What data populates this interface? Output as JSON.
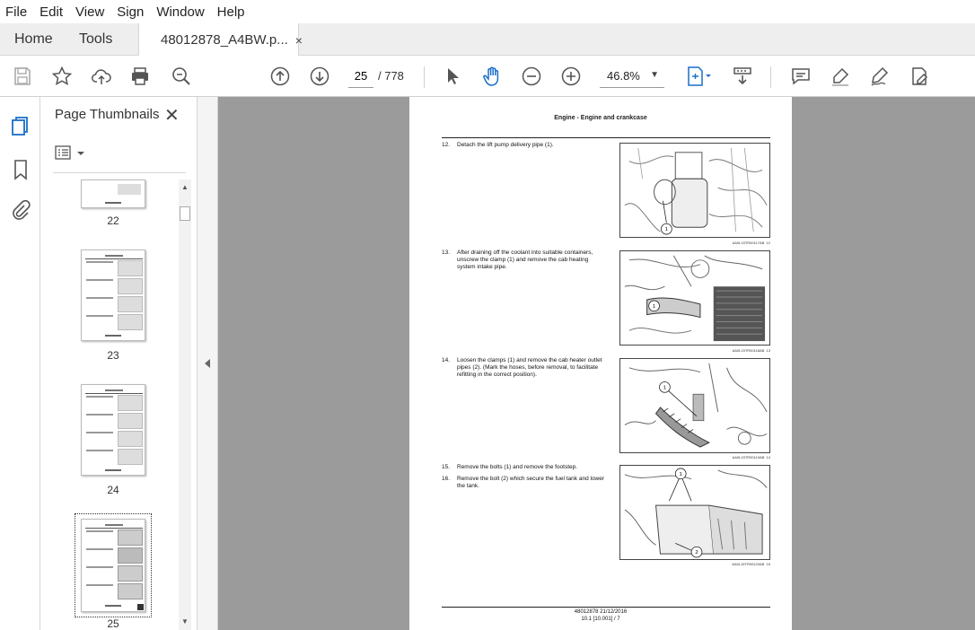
{
  "menu": [
    "File",
    "Edit",
    "View",
    "Sign",
    "Window",
    "Help"
  ],
  "tabs": {
    "home": "Home",
    "tools": "Tools",
    "doc": "48012878_A4BW.p...",
    "doc_close": "×"
  },
  "toolbar": {
    "current_page": "25",
    "total_pages": "/ 778",
    "zoom": "46.8%"
  },
  "thumbnails": {
    "title": "Page Thumbnails",
    "close": "✕",
    "pages": [
      "22",
      "23",
      "24",
      "25"
    ],
    "selected": "25"
  },
  "document": {
    "header": "Engine - Engine and crankcase",
    "steps": [
      {
        "num": "12.",
        "text": "Detach the lift pump delivery pipe (1)."
      },
      {
        "num": "13.",
        "text": "After draining off the coolant into suitable containers, unscrew the clamp (1) and remove the cab heating system intake pipe."
      },
      {
        "num": "14.",
        "text": "Loosen the clamps (1) and remove the cab heater outlet pipes (2). (Mark the hoses, before removal, to facilitate refitting in the correct position)."
      },
      {
        "num": "15.",
        "text": "Remove the bolts (1) and remove the footstep."
      },
      {
        "num": "16.",
        "text": "Remove the bolt (2) which secure the fuel tank and lower the tank."
      }
    ],
    "figures": [
      {
        "caption": "AA0L15TR00117AB",
        "num": "12"
      },
      {
        "caption": "AA0L15TR00118AB",
        "num": "13"
      },
      {
        "caption": "AA0L15TR00119AB",
        "num": "14"
      },
      {
        "caption": "AA0L15TR00120AB",
        "num": "15"
      }
    ],
    "footer_line1": "48012878 21/12/2016",
    "footer_line2": "10.1 [10.001] / 7"
  }
}
